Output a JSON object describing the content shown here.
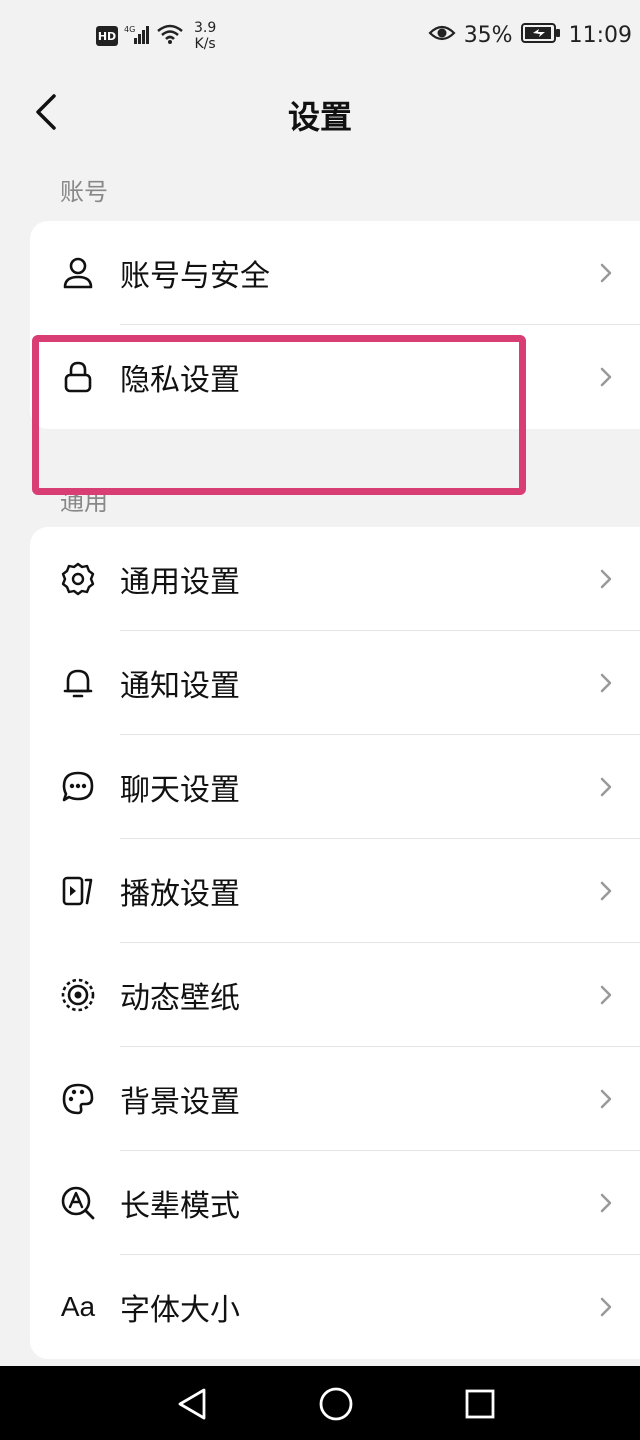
{
  "status_bar": {
    "hd": "HD",
    "net_speed_value": "3.9",
    "net_speed_unit": "K/s",
    "battery": "35%",
    "time": "11:09"
  },
  "header": {
    "title": "设置"
  },
  "sections": {
    "account": {
      "title": "账号",
      "items": [
        {
          "label": "账号与安全",
          "icon": "user-icon"
        },
        {
          "label": "隐私设置",
          "icon": "lock-icon"
        }
      ]
    },
    "general": {
      "title": "通用",
      "items": [
        {
          "label": "通用设置",
          "icon": "gear-icon"
        },
        {
          "label": "通知设置",
          "icon": "bell-icon"
        },
        {
          "label": "聊天设置",
          "icon": "chat-bubble-icon"
        },
        {
          "label": "播放设置",
          "icon": "play-settings-icon"
        },
        {
          "label": "动态壁纸",
          "icon": "live-wallpaper-icon"
        },
        {
          "label": "背景设置",
          "icon": "palette-icon"
        },
        {
          "label": "长辈模式",
          "icon": "elder-mode-icon"
        },
        {
          "label": "字体大小",
          "icon": "font-size-icon"
        }
      ]
    }
  },
  "font_icon_glyph": "Aa",
  "colors": {
    "highlight": "#d83d73",
    "background": "#f2f2f2",
    "card": "#ffffff"
  }
}
